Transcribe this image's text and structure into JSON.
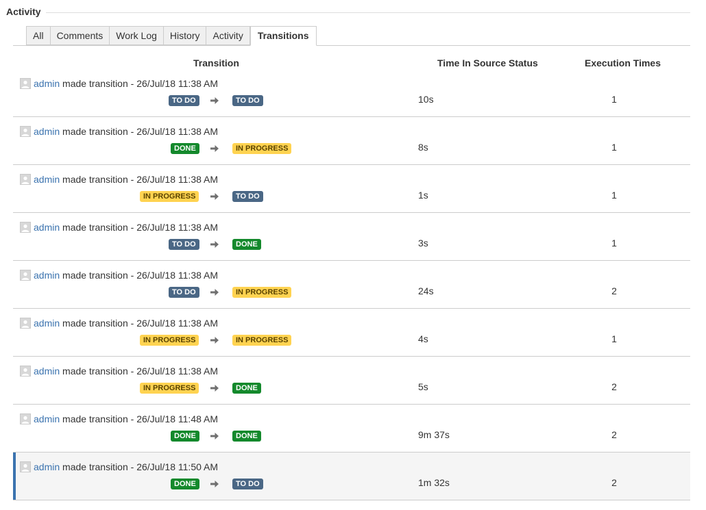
{
  "section": {
    "title": "Activity"
  },
  "tabs": [
    {
      "label": "All",
      "active": false
    },
    {
      "label": "Comments",
      "active": false
    },
    {
      "label": "Work Log",
      "active": false
    },
    {
      "label": "History",
      "active": false
    },
    {
      "label": "Activity",
      "active": false
    },
    {
      "label": "Transitions",
      "active": true
    }
  ],
  "table": {
    "headers": {
      "transition": "Transition",
      "time": "Time In Source Status",
      "exec": "Execution Times"
    },
    "arrow_icon": "right-arrow-icon",
    "avatar_icon": "user-avatar-icon",
    "status_colors": {
      "todo": "#4a6785",
      "done": "#14892c",
      "inprogress": "#ffd351"
    },
    "rows": [
      {
        "user": "admin",
        "text": " made transition - 26/Jul/18 11:38 AM",
        "from": "TO DO",
        "from_type": "todo",
        "to": "TO DO",
        "to_type": "todo",
        "time": "10s",
        "exec": "1",
        "selected": false
      },
      {
        "user": "admin",
        "text": " made transition - 26/Jul/18 11:38 AM",
        "from": "DONE",
        "from_type": "done",
        "to": "IN PROGRESS",
        "to_type": "inprogress",
        "time": "8s",
        "exec": "1",
        "selected": false
      },
      {
        "user": "admin",
        "text": " made transition - 26/Jul/18 11:38 AM",
        "from": "IN PROGRESS",
        "from_type": "inprogress",
        "to": "TO DO",
        "to_type": "todo",
        "time": "1s",
        "exec": "1",
        "selected": false
      },
      {
        "user": "admin",
        "text": " made transition - 26/Jul/18 11:38 AM",
        "from": "TO DO",
        "from_type": "todo",
        "to": "DONE",
        "to_type": "done",
        "time": "3s",
        "exec": "1",
        "selected": false
      },
      {
        "user": "admin",
        "text": " made transition - 26/Jul/18 11:38 AM",
        "from": "TO DO",
        "from_type": "todo",
        "to": "IN PROGRESS",
        "to_type": "inprogress",
        "time": "24s",
        "exec": "2",
        "selected": false
      },
      {
        "user": "admin",
        "text": " made transition - 26/Jul/18 11:38 AM",
        "from": "IN PROGRESS",
        "from_type": "inprogress",
        "to": "IN PROGRESS",
        "to_type": "inprogress",
        "time": "4s",
        "exec": "1",
        "selected": false
      },
      {
        "user": "admin",
        "text": " made transition - 26/Jul/18 11:38 AM",
        "from": "IN PROGRESS",
        "from_type": "inprogress",
        "to": "DONE",
        "to_type": "done",
        "time": "5s",
        "exec": "2",
        "selected": false
      },
      {
        "user": "admin",
        "text": " made transition - 26/Jul/18 11:48 AM",
        "from": "DONE",
        "from_type": "done",
        "to": "DONE",
        "to_type": "done",
        "time": "9m 37s",
        "exec": "2",
        "selected": false
      },
      {
        "user": "admin",
        "text": " made transition - 26/Jul/18 11:50 AM",
        "from": "DONE",
        "from_type": "done",
        "to": "TO DO",
        "to_type": "todo",
        "time": "1m 32s",
        "exec": "2",
        "selected": true
      }
    ]
  }
}
